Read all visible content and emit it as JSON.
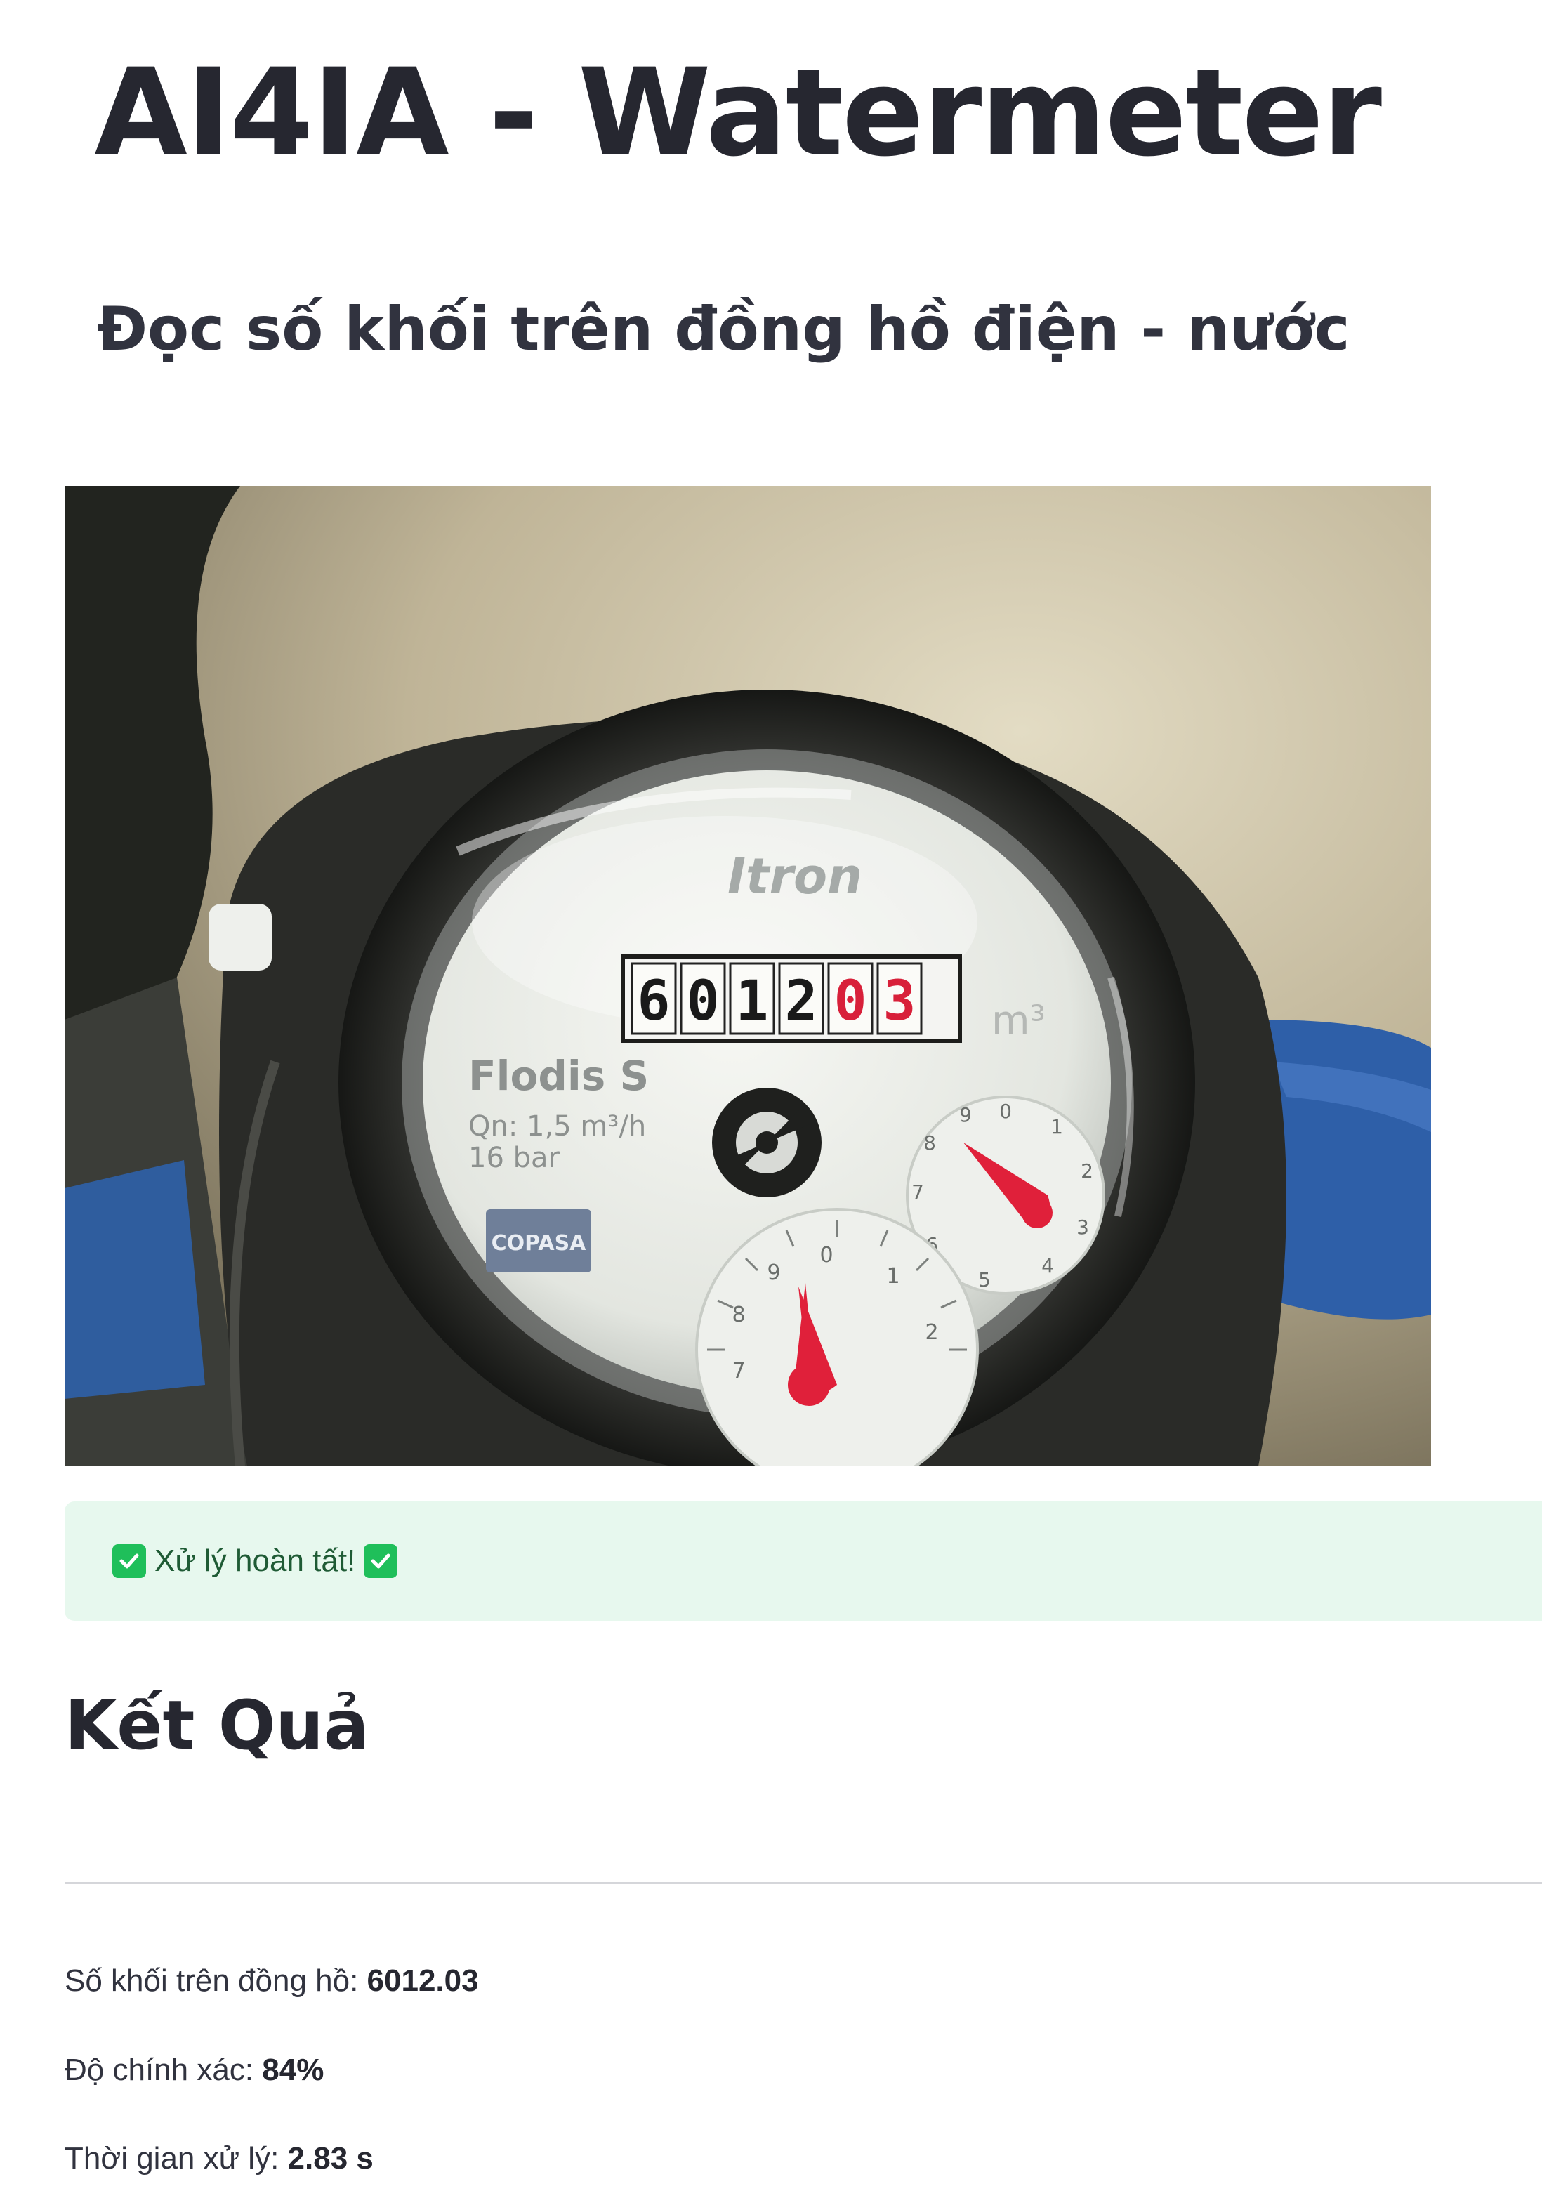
{
  "header": {
    "title": "AI4IA - Watermeter",
    "subtitle": "Đọc số khối trên đồng hồ điện - nước"
  },
  "photo": {
    "brand": "Itron",
    "model": "Flodis S",
    "spec_qn": "Qn: 1,5 m³/h",
    "spec_pressure": "16 bar",
    "counter_digits": [
      "6",
      "0",
      "1",
      "2",
      "0",
      "3"
    ],
    "unit": "m³",
    "sticker": "COPASA",
    "dial_numbers": [
      "0",
      "1",
      "2",
      "3",
      "4",
      "5",
      "6",
      "7",
      "8",
      "9"
    ],
    "colors": {
      "background_wall": "#b9ad8d",
      "meter_body": "#2c2d2b",
      "pipe_blue": "#2e5fa8",
      "needle_red": "#e0203a"
    }
  },
  "alert": {
    "icon": "check-box-icon",
    "message": "Xử lý hoàn tất!",
    "color": "#e7f8ee"
  },
  "results": {
    "heading": "Kết Quả",
    "reading_label": "Số khối trên đồng hồ:",
    "reading_value": "6012.03",
    "accuracy_label": "Độ chính xác:",
    "accuracy_value": "84%",
    "time_label": "Thời gian xử lý:",
    "time_value": "2.83 s"
  }
}
